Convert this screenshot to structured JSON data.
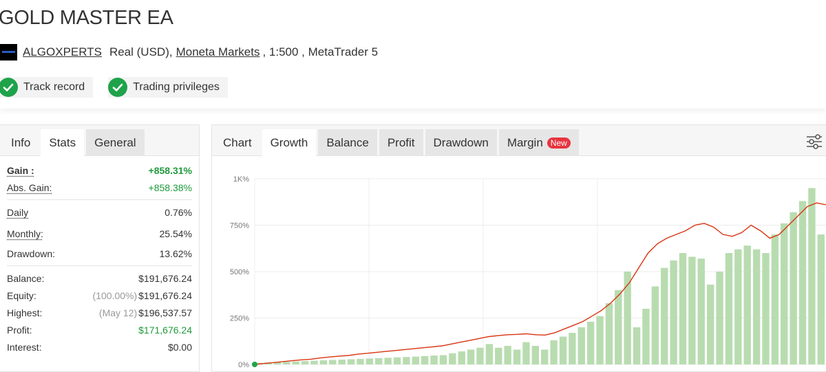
{
  "header": {
    "title": "GOLD MASTER EA",
    "owner_link": "ALGOXPERTS",
    "account_type": "Real (USD),",
    "broker_link": "Moneta Markets",
    "leverage_platform": ", 1:500 , MetaTrader 5",
    "badges": [
      {
        "label": "Track record",
        "icon": "check-icon"
      },
      {
        "label": "Trading privileges",
        "icon": "check-icon"
      }
    ]
  },
  "left_tabs": [
    "Info",
    "Stats",
    "General"
  ],
  "stats": {
    "gain": {
      "label": "Gain :",
      "value": "+858.31%"
    },
    "abs_gain": {
      "label": "Abs. Gain:",
      "value": "+858.38%"
    },
    "daily": {
      "label": "Daily",
      "value": "0.76%"
    },
    "monthly": {
      "label": "Monthly:",
      "value": "25.54%"
    },
    "drawdown": {
      "label": "Drawdown:",
      "value": "13.62%"
    },
    "balance": {
      "label": "Balance:",
      "value": "$191,676.24"
    },
    "equity": {
      "label": "Equity:",
      "pct": "(100.00%)",
      "value": "$191,676.24"
    },
    "highest": {
      "label": "Highest:",
      "date": "(May 12)",
      "value": "$196,537.57"
    },
    "profit": {
      "label": "Profit:",
      "value": "$171,676.24"
    },
    "interest": {
      "label": "Interest:",
      "value": "$0.00"
    }
  },
  "chart_tabs": {
    "chart": "Chart",
    "growth": "Growth",
    "balance": "Balance",
    "profit": "Profit",
    "drawdown": "Drawdown",
    "margin": "Margin",
    "new_badge": "New"
  },
  "colors": {
    "growth_line": "#d9330f",
    "bars": "#b8dcb0",
    "gain_green": "#1e9a3a",
    "new_badge": "#e8343f",
    "check": "#1fa34a"
  },
  "chart_data": {
    "type": "line",
    "y_tick_labels": [
      "0%",
      "250%",
      "500%",
      "750%",
      "1K%"
    ],
    "ylim": [
      0,
      1000
    ],
    "grid": true,
    "series": [
      {
        "values": [
          0,
          5,
          10,
          15,
          20,
          25,
          28,
          35,
          40,
          45,
          48,
          55,
          60,
          65,
          70,
          75,
          80,
          85,
          90,
          95,
          100,
          110,
          120,
          130,
          140,
          150,
          155,
          160,
          162,
          165,
          160,
          158,
          170,
          190,
          210,
          230,
          260,
          290,
          330,
          380,
          440,
          520,
          600,
          650,
          680,
          700,
          720,
          750,
          760,
          740,
          700,
          690,
          710,
          750,
          720,
          680,
          700,
          750,
          800,
          850,
          870,
          860
        ]
      }
    ],
    "bars": [
      8,
      10,
      12,
      14,
      16,
      18,
      20,
      22,
      24,
      26,
      28,
      30,
      32,
      34,
      36,
      38,
      40,
      42,
      45,
      48,
      50,
      60,
      70,
      80,
      90,
      110,
      90,
      100,
      80,
      120,
      100,
      80,
      130,
      150,
      170,
      200,
      230,
      260,
      330,
      400,
      500,
      200,
      300,
      420,
      520,
      560,
      600,
      580,
      570,
      430,
      500,
      600,
      620,
      640,
      620,
      600,
      700,
      760,
      820,
      880,
      950,
      700
    ]
  }
}
